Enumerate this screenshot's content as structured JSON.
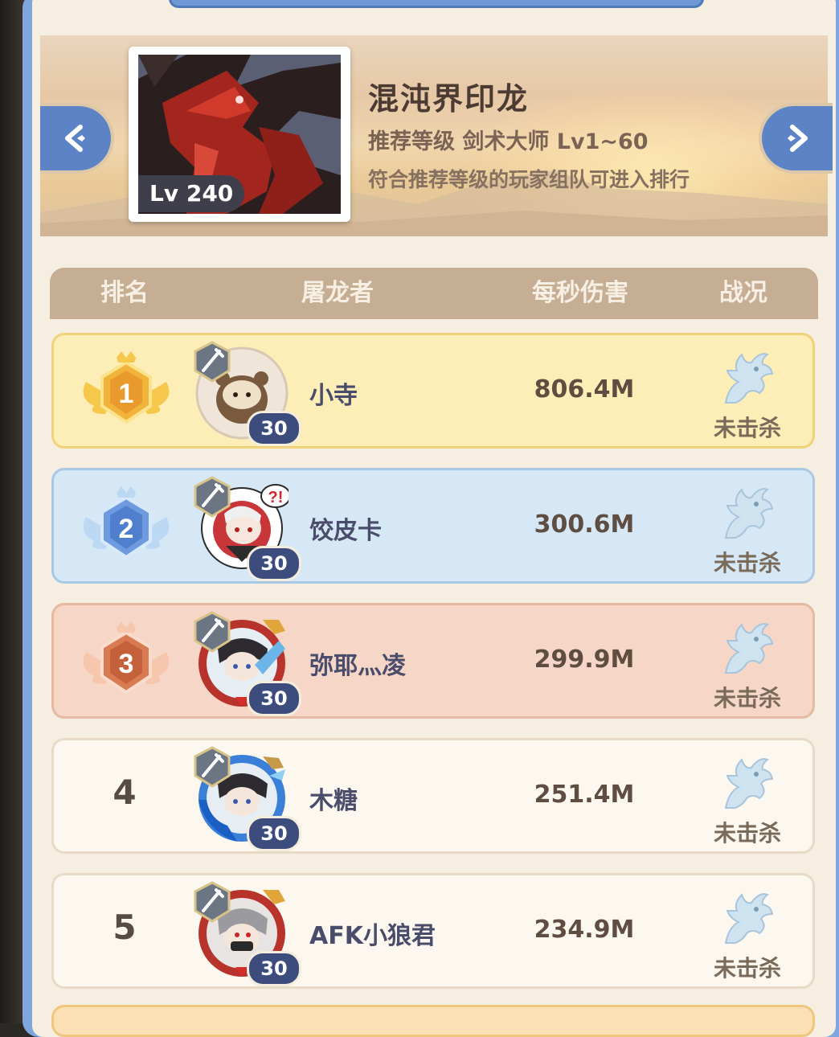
{
  "boss": {
    "name": "混沌界印龙",
    "level_badge": "Lv 240",
    "recommendation": "推荐等级 剑术大师 Lv1~60",
    "note": "符合推荐等级的玩家组队可进入排行"
  },
  "table_header": {
    "rank": "排名",
    "slayer": "屠龙者",
    "dps": "每秒伤害",
    "status": "战况"
  },
  "rows": [
    {
      "rank": "1",
      "name": "小寺",
      "dps": "806.4M",
      "status": "未击杀",
      "level": "30"
    },
    {
      "rank": "2",
      "name": "饺皮卡",
      "dps": "300.6M",
      "status": "未击杀",
      "level": "30"
    },
    {
      "rank": "3",
      "name": "弥耶灬凌",
      "dps": "299.9M",
      "status": "未击杀",
      "level": "30"
    },
    {
      "rank": "4",
      "name": "木糖",
      "dps": "251.4M",
      "status": "未击杀",
      "level": "30"
    },
    {
      "rank": "5",
      "name": "AFK小狼君",
      "dps": "234.9M",
      "status": "未击杀",
      "level": "30"
    }
  ],
  "colors": {
    "frame_blue": "#7fa6de",
    "gold_row": "#fdedb7",
    "silver_row": "#d6e8f6",
    "bronze_row": "#f6d6c6",
    "plain_row": "#fdf8ef"
  },
  "icons": {
    "prev": "chevron-left-icon",
    "next": "chevron-right-icon",
    "status": "dragon-head-icon",
    "badge": "sword-icon"
  }
}
